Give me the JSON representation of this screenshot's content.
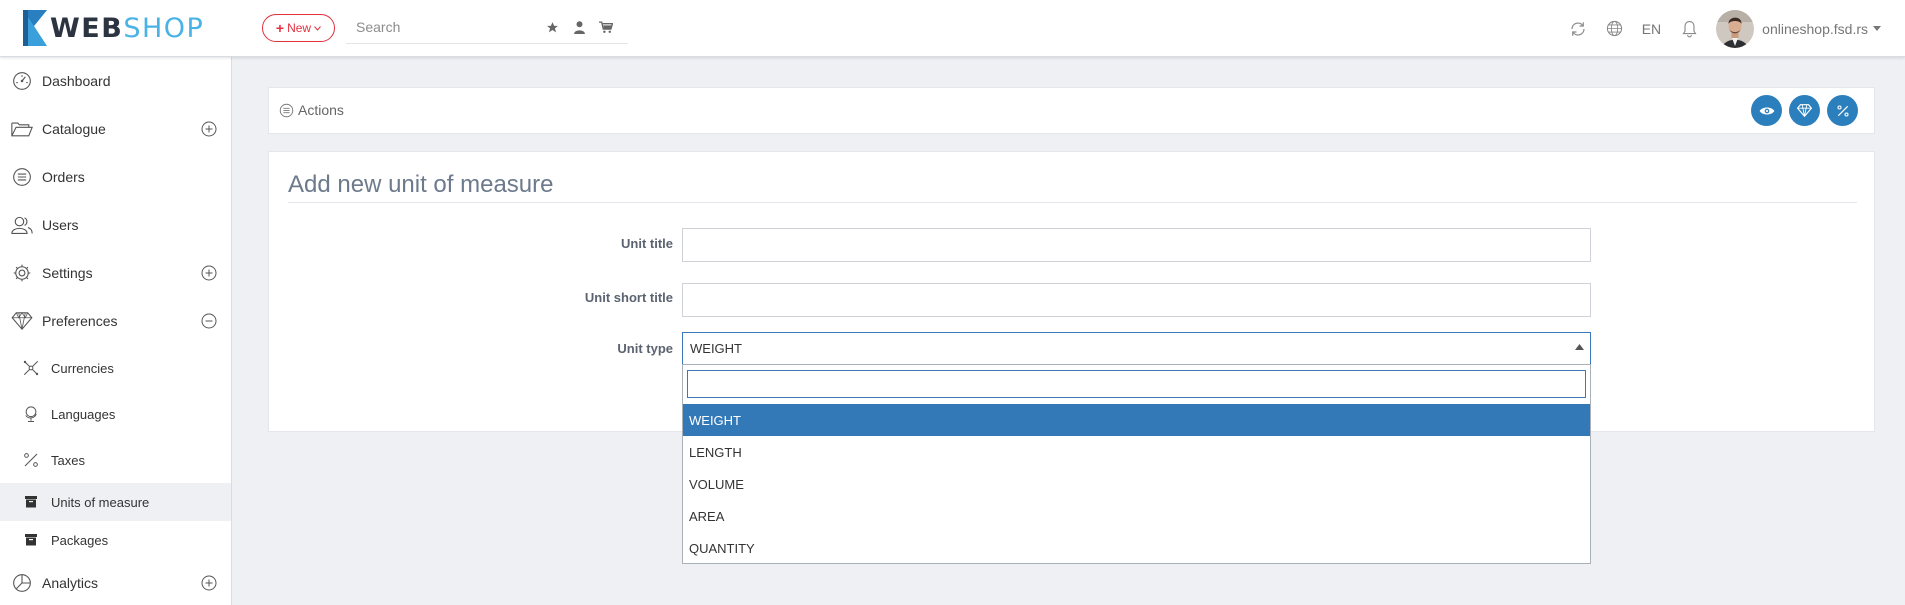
{
  "brand": {
    "part1": "WEB",
    "part2": "SHOP"
  },
  "header": {
    "new_label": "New",
    "search_placeholder": "Search",
    "language": "EN",
    "username": "onlineshop.fsd.rs"
  },
  "sidebar": {
    "items": [
      {
        "label": "Dashboard",
        "icon": "dashboard-icon"
      },
      {
        "label": "Catalogue",
        "icon": "folder-icon"
      },
      {
        "label": "Orders",
        "icon": "orders-icon"
      },
      {
        "label": "Users",
        "icon": "users-icon"
      },
      {
        "label": "Settings",
        "icon": "gear-icon"
      },
      {
        "label": "Preferences",
        "icon": "diamond-icon"
      }
    ],
    "sub_items": [
      {
        "label": "Currencies",
        "icon": "currencies-icon"
      },
      {
        "label": "Languages",
        "icon": "globe-icon"
      },
      {
        "label": "Taxes",
        "icon": "percent-icon"
      },
      {
        "label": "Units of measure",
        "icon": "archive-icon"
      },
      {
        "label": "Packages",
        "icon": "archive-icon"
      }
    ],
    "analytics": {
      "label": "Analytics",
      "icon": "pie-chart-icon"
    }
  },
  "actions": {
    "label": "Actions"
  },
  "form": {
    "title": "Add new unit of measure",
    "unit_title_label": "Unit title",
    "unit_title_value": "",
    "unit_short_title_label": "Unit short title",
    "unit_short_title_value": "",
    "unit_type_label": "Unit type",
    "unit_type_value": "WEIGHT"
  },
  "dropdown": {
    "search_value": "",
    "options": [
      "WEIGHT",
      "LENGTH",
      "VOLUME",
      "AREA",
      "QUANTITY"
    ],
    "selected": "WEIGHT"
  },
  "colors": {
    "accent": "#2c7fbd",
    "danger": "#e2303e",
    "brand_light": "#4ab3e6",
    "selected": "#3379b7"
  }
}
